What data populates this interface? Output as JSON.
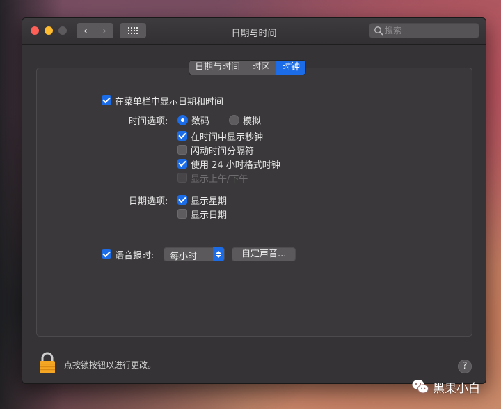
{
  "window": {
    "title": "日期与时间"
  },
  "toolbar": {
    "back_glyph": "‹",
    "forward_glyph": "›"
  },
  "search": {
    "placeholder": "搜索"
  },
  "tabs": [
    {
      "label": "日期与时间",
      "active": false
    },
    {
      "label": "时区",
      "active": false
    },
    {
      "label": "时钟",
      "active": true
    }
  ],
  "clock": {
    "show_in_menubar": {
      "label": "在菜单栏中显示日期和时间",
      "checked": true
    },
    "time_options": {
      "label": "时间选项:",
      "radios": [
        {
          "label": "数码",
          "selected": true
        },
        {
          "label": "模拟",
          "selected": false
        }
      ],
      "checkboxes": [
        {
          "label": "在时间中显示秒钟",
          "checked": true,
          "enabled": true
        },
        {
          "label": "闪动时间分隔符",
          "checked": false,
          "enabled": true
        },
        {
          "label": "使用 24 小时格式时钟",
          "checked": true,
          "enabled": true
        },
        {
          "label": "显示上午/下午",
          "checked": false,
          "enabled": false
        }
      ]
    },
    "date_options": {
      "label": "日期选项:",
      "checkboxes": [
        {
          "label": "显示星期",
          "checked": true
        },
        {
          "label": "显示日期",
          "checked": false
        }
      ]
    },
    "announce": {
      "label": "语音报时:",
      "checked": true,
      "interval_value": "每小时",
      "custom_voice_label": "自定声音..."
    }
  },
  "footer": {
    "lock_text": "点按锁按钮以进行更改。",
    "help_glyph": "?"
  },
  "watermark": {
    "text": "黑果小白"
  },
  "colors": {
    "accent": "#1b6ce6",
    "window_bg": "#353335",
    "lock": "#f5a623"
  }
}
